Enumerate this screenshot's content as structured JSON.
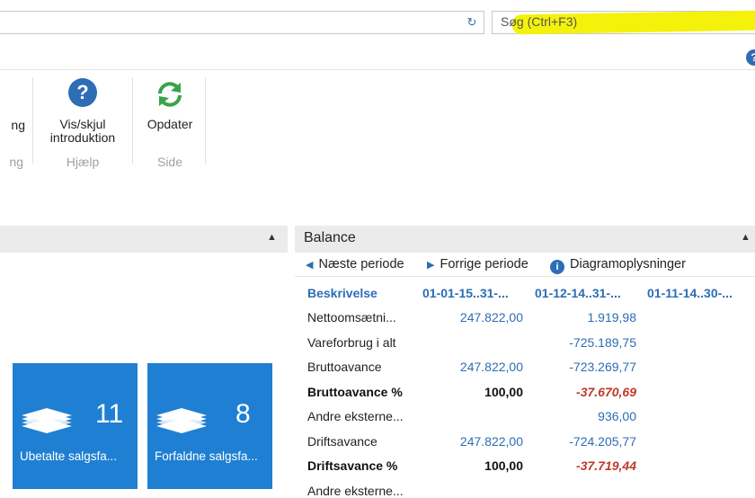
{
  "topbar": {
    "search_placeholder": "Søg (Ctrl+F3)",
    "info_icon": "info-icon",
    "refresh_icon": "refresh-icon"
  },
  "ribbon": {
    "partial_label": "ng",
    "partial_group": "ng",
    "help_button": {
      "line1": "Vis/skjul",
      "line2": "introduktion",
      "group": "Hjælp",
      "icon": "help-icon"
    },
    "refresh_button": {
      "label": "Opdater",
      "group": "Side",
      "icon": "refresh-icon"
    }
  },
  "left_panel": {
    "tiles": [
      {
        "count": "11",
        "label": "Ubetalte salgsfa...",
        "icon": "document-stack-icon"
      },
      {
        "count": "8",
        "label": "Forfaldne salgsfa...",
        "icon": "document-stack-icon"
      }
    ]
  },
  "balance": {
    "title": "Balance",
    "nav": {
      "next": "Næste periode",
      "prev": "Forrige periode",
      "info": "Diagramoplysninger"
    },
    "columns": [
      "Beskrivelse",
      "01-01-15..31-...",
      "01-12-14..31-...",
      "01-11-14..30-..."
    ],
    "rows": [
      {
        "desc": "Nettoomsætni...",
        "c1": "247.822,00",
        "c2": "1.919,98",
        "style": "normal"
      },
      {
        "desc": "Vareforbrug i alt",
        "c1": "",
        "c2": "-725.189,75",
        "style": "normal"
      },
      {
        "desc": "Bruttoavance",
        "c1": "247.822,00",
        "c2": "-723.269,77",
        "style": "normal"
      },
      {
        "desc": "Bruttoavance %",
        "c1": "100,00",
        "c2": "-37.670,69",
        "style": "bold"
      },
      {
        "desc": "Andre eksterne...",
        "c1": "",
        "c2": "936,00",
        "style": "normal"
      },
      {
        "desc": "Driftsavance",
        "c1": "247.822,00",
        "c2": "-724.205,77",
        "style": "normal"
      },
      {
        "desc": "Driftsavance %",
        "c1": "100,00",
        "c2": "-37.719,44",
        "style": "bold"
      },
      {
        "desc": "Andre eksterne...",
        "c1": "",
        "c2": "",
        "style": "normal"
      }
    ]
  },
  "colors": {
    "accent": "#2d6db5",
    "tile": "#1f7fd2",
    "negative": "#c0392b",
    "highlight": "#f4f20a"
  }
}
